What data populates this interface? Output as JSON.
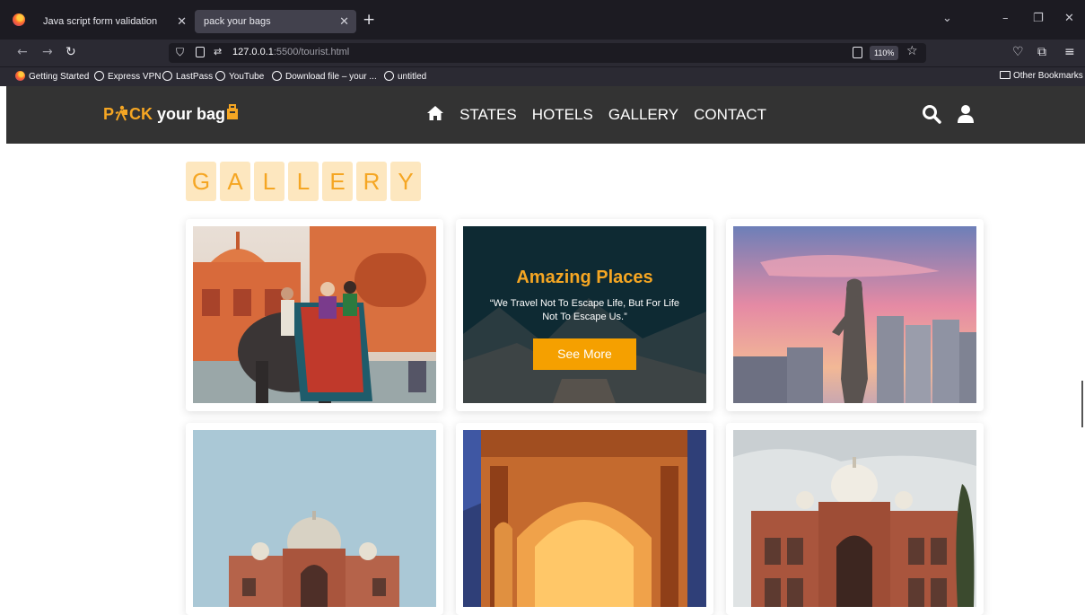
{
  "browser": {
    "tabs": [
      {
        "title": "Java script form validation"
      },
      {
        "title": "pack your bags",
        "active": true
      }
    ],
    "url_host": "127.0.0.1",
    "url_rest": ":5500/tourist.html",
    "zoom": "110%",
    "bookmarks": [
      "Getting Started",
      "Express VPN",
      "LastPass",
      "YouTube",
      "Download file – your ...",
      "untitled"
    ],
    "other_bookmarks": "Other Bookmarks"
  },
  "site": {
    "logo_p": "P",
    "logo_ck": "CK",
    "logo_your": " your bag",
    "nav": {
      "states": "STATES",
      "hotels": "HOTELS",
      "gallery": "GALLERY",
      "contact": "CONTACT"
    },
    "gallery_letters": [
      "G",
      "A",
      "L",
      "L",
      "E",
      "R",
      "Y"
    ],
    "promo": {
      "title": "Amazing Places",
      "quote": "“We Travel Not To Escape Life, But For Life Not To Escape Us.”",
      "button": "See More"
    }
  },
  "colors": {
    "accent": "#f5a623",
    "nav_bg": "#333333",
    "browser_bg": "#1c1b22"
  }
}
